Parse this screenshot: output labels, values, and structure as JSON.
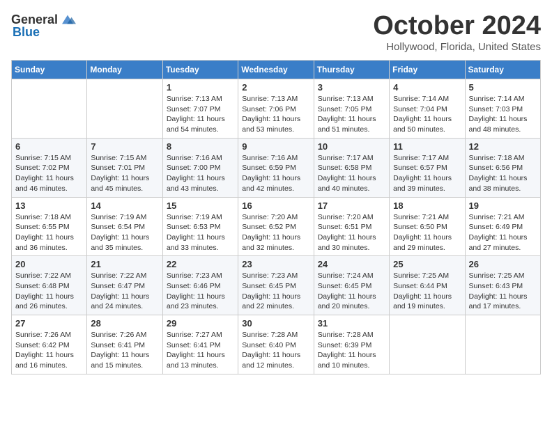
{
  "logo": {
    "text_general": "General",
    "text_blue": "Blue"
  },
  "header": {
    "month_title": "October 2024",
    "location": "Hollywood, Florida, United States"
  },
  "weekdays": [
    "Sunday",
    "Monday",
    "Tuesday",
    "Wednesday",
    "Thursday",
    "Friday",
    "Saturday"
  ],
  "weeks": [
    [
      {
        "day": "",
        "info": ""
      },
      {
        "day": "",
        "info": ""
      },
      {
        "day": "1",
        "info": "Sunrise: 7:13 AM\nSunset: 7:07 PM\nDaylight: 11 hours and 54 minutes."
      },
      {
        "day": "2",
        "info": "Sunrise: 7:13 AM\nSunset: 7:06 PM\nDaylight: 11 hours and 53 minutes."
      },
      {
        "day": "3",
        "info": "Sunrise: 7:13 AM\nSunset: 7:05 PM\nDaylight: 11 hours and 51 minutes."
      },
      {
        "day": "4",
        "info": "Sunrise: 7:14 AM\nSunset: 7:04 PM\nDaylight: 11 hours and 50 minutes."
      },
      {
        "day": "5",
        "info": "Sunrise: 7:14 AM\nSunset: 7:03 PM\nDaylight: 11 hours and 48 minutes."
      }
    ],
    [
      {
        "day": "6",
        "info": "Sunrise: 7:15 AM\nSunset: 7:02 PM\nDaylight: 11 hours and 46 minutes."
      },
      {
        "day": "7",
        "info": "Sunrise: 7:15 AM\nSunset: 7:01 PM\nDaylight: 11 hours and 45 minutes."
      },
      {
        "day": "8",
        "info": "Sunrise: 7:16 AM\nSunset: 7:00 PM\nDaylight: 11 hours and 43 minutes."
      },
      {
        "day": "9",
        "info": "Sunrise: 7:16 AM\nSunset: 6:59 PM\nDaylight: 11 hours and 42 minutes."
      },
      {
        "day": "10",
        "info": "Sunrise: 7:17 AM\nSunset: 6:58 PM\nDaylight: 11 hours and 40 minutes."
      },
      {
        "day": "11",
        "info": "Sunrise: 7:17 AM\nSunset: 6:57 PM\nDaylight: 11 hours and 39 minutes."
      },
      {
        "day": "12",
        "info": "Sunrise: 7:18 AM\nSunset: 6:56 PM\nDaylight: 11 hours and 38 minutes."
      }
    ],
    [
      {
        "day": "13",
        "info": "Sunrise: 7:18 AM\nSunset: 6:55 PM\nDaylight: 11 hours and 36 minutes."
      },
      {
        "day": "14",
        "info": "Sunrise: 7:19 AM\nSunset: 6:54 PM\nDaylight: 11 hours and 35 minutes."
      },
      {
        "day": "15",
        "info": "Sunrise: 7:19 AM\nSunset: 6:53 PM\nDaylight: 11 hours and 33 minutes."
      },
      {
        "day": "16",
        "info": "Sunrise: 7:20 AM\nSunset: 6:52 PM\nDaylight: 11 hours and 32 minutes."
      },
      {
        "day": "17",
        "info": "Sunrise: 7:20 AM\nSunset: 6:51 PM\nDaylight: 11 hours and 30 minutes."
      },
      {
        "day": "18",
        "info": "Sunrise: 7:21 AM\nSunset: 6:50 PM\nDaylight: 11 hours and 29 minutes."
      },
      {
        "day": "19",
        "info": "Sunrise: 7:21 AM\nSunset: 6:49 PM\nDaylight: 11 hours and 27 minutes."
      }
    ],
    [
      {
        "day": "20",
        "info": "Sunrise: 7:22 AM\nSunset: 6:48 PM\nDaylight: 11 hours and 26 minutes."
      },
      {
        "day": "21",
        "info": "Sunrise: 7:22 AM\nSunset: 6:47 PM\nDaylight: 11 hours and 24 minutes."
      },
      {
        "day": "22",
        "info": "Sunrise: 7:23 AM\nSunset: 6:46 PM\nDaylight: 11 hours and 23 minutes."
      },
      {
        "day": "23",
        "info": "Sunrise: 7:23 AM\nSunset: 6:45 PM\nDaylight: 11 hours and 22 minutes."
      },
      {
        "day": "24",
        "info": "Sunrise: 7:24 AM\nSunset: 6:45 PM\nDaylight: 11 hours and 20 minutes."
      },
      {
        "day": "25",
        "info": "Sunrise: 7:25 AM\nSunset: 6:44 PM\nDaylight: 11 hours and 19 minutes."
      },
      {
        "day": "26",
        "info": "Sunrise: 7:25 AM\nSunset: 6:43 PM\nDaylight: 11 hours and 17 minutes."
      }
    ],
    [
      {
        "day": "27",
        "info": "Sunrise: 7:26 AM\nSunset: 6:42 PM\nDaylight: 11 hours and 16 minutes."
      },
      {
        "day": "28",
        "info": "Sunrise: 7:26 AM\nSunset: 6:41 PM\nDaylight: 11 hours and 15 minutes."
      },
      {
        "day": "29",
        "info": "Sunrise: 7:27 AM\nSunset: 6:41 PM\nDaylight: 11 hours and 13 minutes."
      },
      {
        "day": "30",
        "info": "Sunrise: 7:28 AM\nSunset: 6:40 PM\nDaylight: 11 hours and 12 minutes."
      },
      {
        "day": "31",
        "info": "Sunrise: 7:28 AM\nSunset: 6:39 PM\nDaylight: 11 hours and 10 minutes."
      },
      {
        "day": "",
        "info": ""
      },
      {
        "day": "",
        "info": ""
      }
    ]
  ]
}
